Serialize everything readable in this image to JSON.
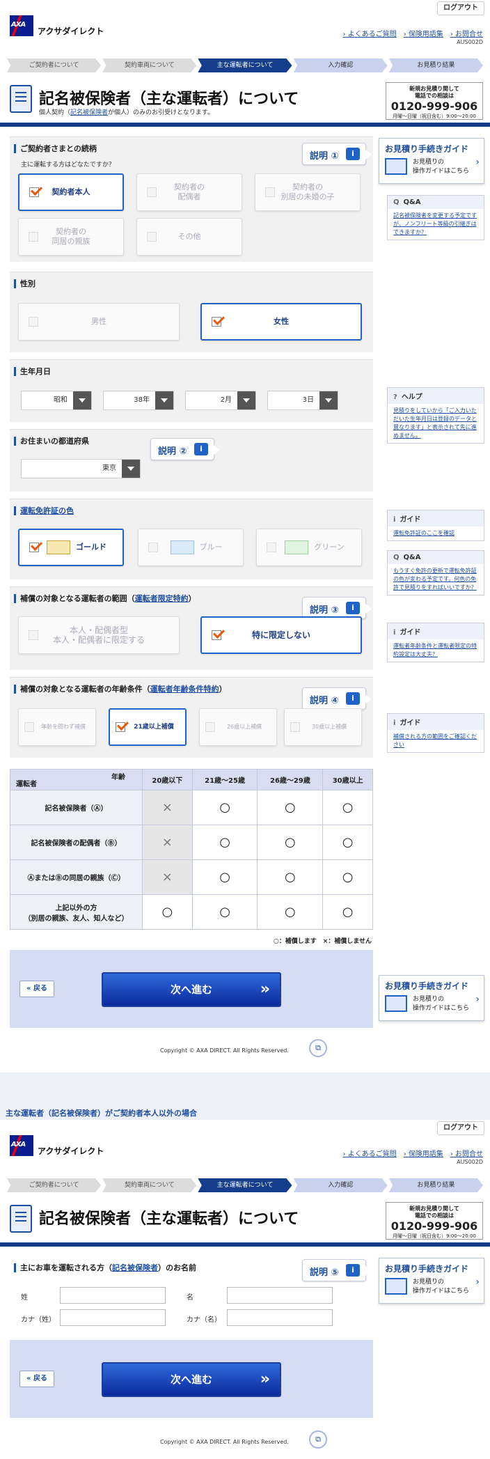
{
  "header": {
    "logout": "ログアウト",
    "brand": "アクサダイレクト",
    "links": [
      "よくあるご質問",
      "保険用語集",
      "お問合せ"
    ],
    "screen_id": "AUS002D"
  },
  "steps": [
    "ご契約者について",
    "契約車両について",
    "主な運転者について",
    "入力確認",
    "お見積り結果"
  ],
  "page": {
    "title": "記名被保険者（主な運転者）について",
    "sub_prefix": "個人契約（",
    "sub_link": "記名被保険者",
    "sub_suffix": "が個人）のみのお引受けとなります。",
    "tel_line1": "新規お見積り関して",
    "tel_line2": "電話での相談は",
    "tel": "0120-999-906",
    "tel_hours": "月曜〜日曜（祝日含む）9:00〜20:00"
  },
  "relation": {
    "title": "ご契約者さまとの続柄",
    "question": "主に運転する方はどなたですか？",
    "explain": "説明 ①",
    "options": [
      "契約者本人",
      "契約者の\n配偶者",
      "契約者の\n別居の未婚の子",
      "契約者の\n同居の親族",
      "その他"
    ]
  },
  "gender": {
    "title": "性別",
    "options": [
      "男性",
      "女性"
    ]
  },
  "birth": {
    "title": "生年月日",
    "era": "昭和",
    "year": "38年",
    "month": "2月",
    "day": "3日"
  },
  "pref": {
    "title": "お住まいの都道府県",
    "value": "東京",
    "explain": "説明 ②"
  },
  "license": {
    "title": "運転免許証の色",
    "options": [
      "ゴールド",
      "ブルー",
      "グリーン"
    ]
  },
  "scope": {
    "title_prefix": "補償の対象となる運転者の範囲（",
    "title_link": "運転者限定特約",
    "title_suffix": "）",
    "explain": "説明 ③",
    "options": [
      "本人・配偶者型\n本人・配偶者に限定する",
      "特に限定しない"
    ]
  },
  "agecond": {
    "title_prefix": "補償の対象となる運転者の年齢条件（",
    "title_link": "運転者年齢条件特約",
    "title_suffix": "）",
    "explain": "説明 ④",
    "options": [
      "年齢を問わず補償",
      "21歳以上補償",
      "26歳以上補償",
      "30歳以上補償"
    ]
  },
  "table": {
    "corner_top": "年齢",
    "corner_bottom": "運転者",
    "cols": [
      "20歳以下",
      "21歳〜25歳",
      "26歳〜29歳",
      "30歳以上"
    ],
    "rows": [
      {
        "label": "記名被保険者（Ⓐ）",
        "v": [
          "×",
          "○",
          "○",
          "○"
        ]
      },
      {
        "label": "記名被保険者の配偶者（Ⓑ）",
        "v": [
          "×",
          "○",
          "○",
          "○"
        ]
      },
      {
        "label": "ⒶまたはⒷの同居の親族（Ⓒ）",
        "v": [
          "×",
          "○",
          "○",
          "○"
        ]
      },
      {
        "label": "上記以外の方\n（別居の親族、友人、知人など）",
        "v": [
          "○",
          "○",
          "○",
          "○"
        ]
      }
    ],
    "legend": "○：補償します　×：補償しません"
  },
  "side": {
    "guide_title": "お見積り手続きガイド",
    "guide_sub": "お見積りの\n操作ガイドはこちら",
    "qa1_head": "Q&A",
    "qa1": "記名被保険者を変更する予定ですが、ノンフリート等級の引継ぎはできますか？",
    "help_head": "ヘルプ",
    "help": "見積りをしていから「ご入力いただいた生年月日は登録のデータと異なります」と表示されて先に進めません。",
    "guide1_head": "ガイド",
    "guide1": "運転免許証のここを確認",
    "qa2_head": "Q&A",
    "qa2": "もうすぐ免許の更新で運転免許証の色が変わる予定です。何色の免許で見積りをすればいいですか？",
    "guide2_head": "ガイド",
    "guide2": "運転者年齢条件と運転者限定の特約設定は大丈夫？",
    "guide3_head": "ガイド",
    "guide3": "補償される方の範囲をご確認ください"
  },
  "buttons": {
    "back": "戻る",
    "next": "次へ進む"
  },
  "copyright": "Copyright © AXA DIRECT. All Rights Reserved.",
  "caption": "主な運転者（記名被保険者）がご契約者本人以外の場合",
  "name": {
    "title_prefix": "主にお車を運転される方（",
    "title_link": "記名被保険者",
    "title_suffix": "）のお名前",
    "explain": "説明 ⑤",
    "sei": "姓",
    "mei": "名",
    "kana_sei": "カナ（姓）",
    "kana_mei": "カナ（名）"
  }
}
